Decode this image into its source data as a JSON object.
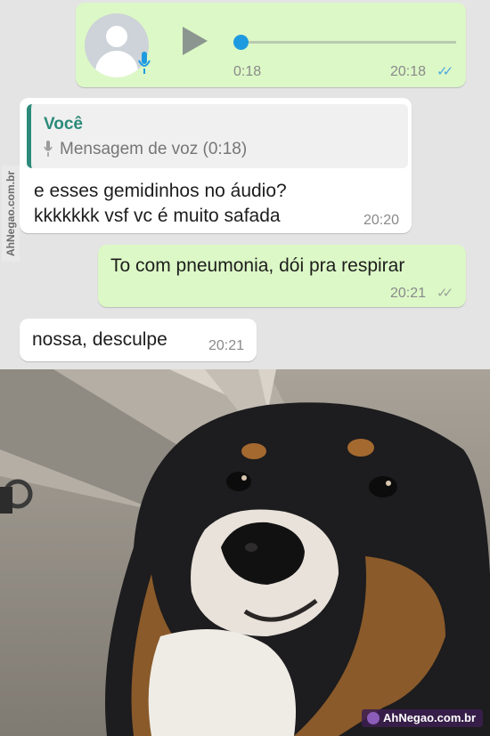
{
  "voice_message": {
    "duration": "0:18",
    "time": "20:18",
    "status_icon": "double-check-read-icon",
    "progress": 0
  },
  "reply_message": {
    "quote_author": "Você",
    "quote_text": "Mensagem de voz (0:18)",
    "line1": "e esses gemidinhos no áudio?",
    "line2": "kkkkkkk vsf vc é muito safada",
    "time": "20:20"
  },
  "pneumonia_message": {
    "text": "To com pneumonia, dói pra respirar",
    "time": "20:21",
    "status_icon": "double-check-delivered-icon"
  },
  "sorry_message": {
    "text": "nossa, desculpe",
    "time": "20:21"
  },
  "watermarks": {
    "side": "AhNegao.com.br",
    "corner": "AhNegao.com.br"
  },
  "colors": {
    "outgoing_bubble": "#dcf8c6",
    "incoming_bubble": "#ffffff",
    "read_ticks": "#4fa8e0",
    "quote_accent": "#2c8a7a",
    "seek_knob": "#1e9be0"
  }
}
